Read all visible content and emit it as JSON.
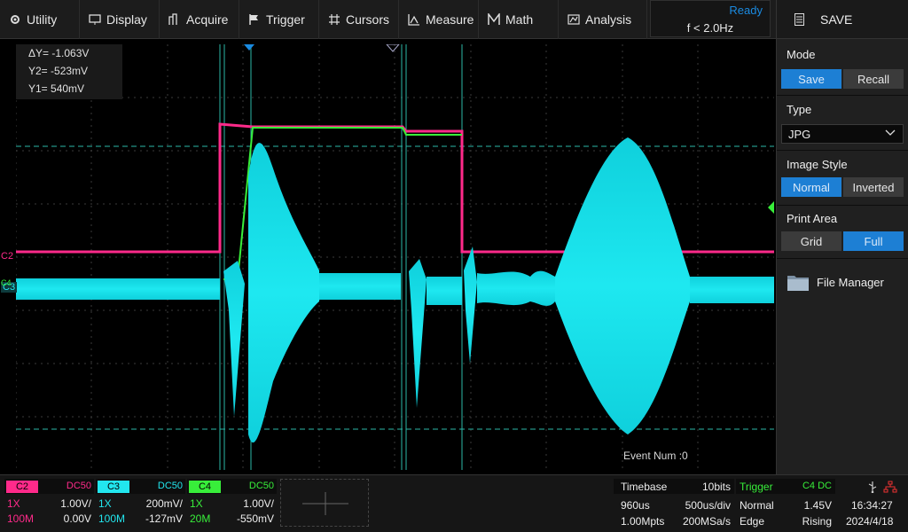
{
  "menu": {
    "items": [
      {
        "label": "Utility",
        "icon": "gear-icon"
      },
      {
        "label": "Display",
        "icon": "monitor-icon"
      },
      {
        "label": "Acquire",
        "icon": "acquire-icon"
      },
      {
        "label": "Trigger",
        "icon": "flag-icon"
      },
      {
        "label": "Cursors",
        "icon": "crosshair-icon"
      },
      {
        "label": "Measure",
        "icon": "measure-icon"
      },
      {
        "label": "Math",
        "icon": "math-icon"
      },
      {
        "label": "Analysis",
        "icon": "analysis-icon"
      }
    ],
    "status": "Ready",
    "freq": "f < 2.0Hz"
  },
  "panel": {
    "title": "SAVE",
    "mode": {
      "label": "Mode",
      "options": [
        "Save",
        "Recall"
      ],
      "selected": "Save"
    },
    "type": {
      "label": "Type",
      "value": "JPG"
    },
    "image_style": {
      "label": "Image Style",
      "options": [
        "Normal",
        "Inverted"
      ],
      "selected": "Normal"
    },
    "print_area": {
      "label": "Print Area",
      "options": [
        "Grid",
        "Full"
      ],
      "selected": "Full"
    },
    "file_manager": "File Manager"
  },
  "cursors": {
    "dy": "ΔY= -1.063V",
    "y2": "Y2= -523mV",
    "y1": "Y1= 540mV"
  },
  "screen": {
    "event_num": "Event Num :0",
    "c2_label": "C2",
    "c3_label": "C3",
    "c4_label": "C4"
  },
  "channels": [
    {
      "name": "C2",
      "coupling": "DC50",
      "probe": "1X",
      "scale": "1.00V/",
      "bw": "100M",
      "offset": "0.00V",
      "color": "#ff2a8a"
    },
    {
      "name": "C3",
      "coupling": "DC50",
      "probe": "1X",
      "scale": "200mV/",
      "bw": "100M",
      "offset": "-127mV",
      "color": "#22e6ee"
    },
    {
      "name": "C4",
      "coupling": "DC50",
      "probe": "1X",
      "scale": "1.00V/",
      "bw": "20M",
      "offset": "-550mV",
      "color": "#38ee3a"
    }
  ],
  "timebase": {
    "label": "Timebase",
    "bits": "10bits",
    "delay": "960us",
    "scale": "500us/div",
    "points": "1.00Mpts",
    "rate": "200MSa/s"
  },
  "trigger": {
    "label": "Trigger",
    "source": "C4 DC",
    "mode": "Normal",
    "level": "1.45V",
    "type": "Edge",
    "slope": "Rising"
  },
  "clock": {
    "time": "16:34:27",
    "date": "2024/4/18"
  }
}
